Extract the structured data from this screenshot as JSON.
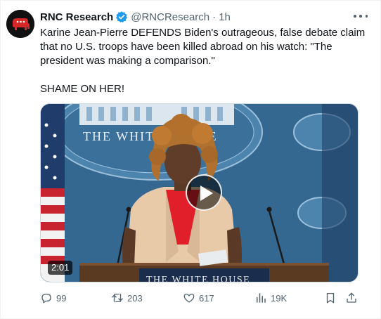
{
  "tweet": {
    "author": {
      "display_name": "RNC Research",
      "verified_icon": "verified-badge-icon",
      "handle": "@RNCResearch",
      "separator": "·",
      "time": "1h",
      "avatar_icon": "republican-elephant-logo"
    },
    "text": {
      "line1": "Karine Jean-Pierre DEFENDS Biden's outrageous, false debate claim that no U.S. troops have been killed abroad on his watch: \"The president was making a comparison.\"",
      "line2": "SHAME ON HER!"
    },
    "media": {
      "type": "video",
      "duration": "2:01",
      "podium_text": "THE WHITE HOUSE",
      "backdrop_text": "THE WHITE HOUSE"
    },
    "actions": {
      "reply_count": "99",
      "retweet_count": "203",
      "like_count": "617",
      "views_count": "19K"
    },
    "colors": {
      "text": "#0f1419",
      "secondary": "#536471",
      "verified": "#1d9bf0",
      "avatar_bg": "#111111",
      "logo_red": "#d62828",
      "backdrop_blue": "#3a6d96"
    }
  }
}
